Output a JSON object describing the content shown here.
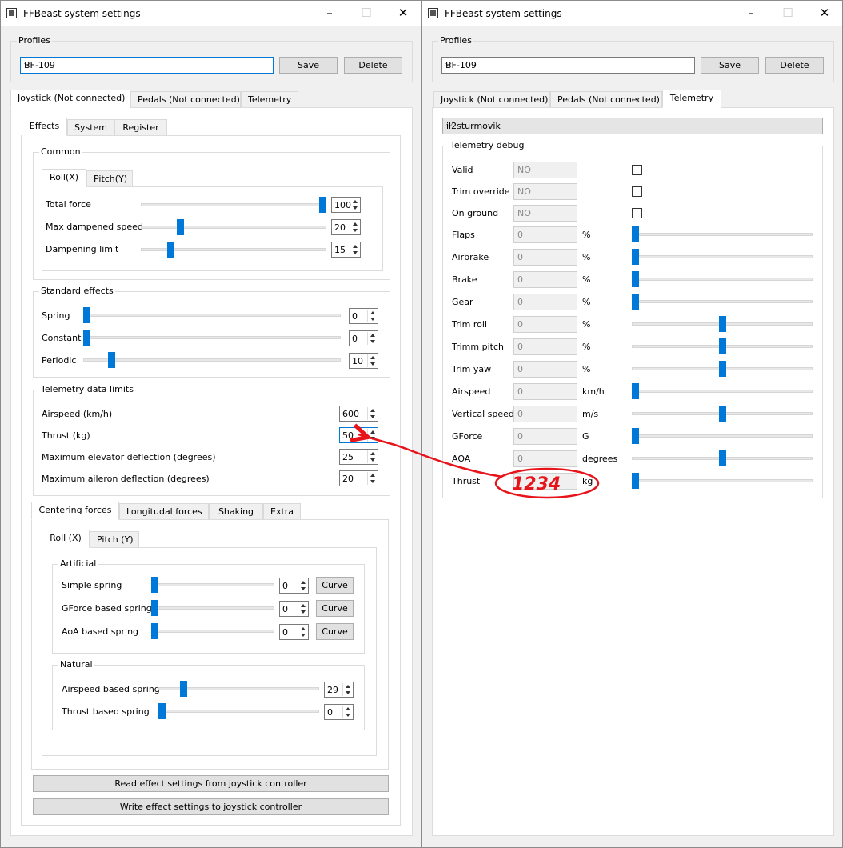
{
  "left_window": {
    "title": "FFBeast system settings",
    "profiles": {
      "label": "Profiles",
      "value": "BF-109",
      "save": "Save",
      "delete": "Delete"
    },
    "main_tabs": [
      "Joystick (Not connected)",
      "Pedals (Not connected)",
      "Telemetry"
    ],
    "sub_tabs": [
      "Effects",
      "System",
      "Register"
    ],
    "common": {
      "label": "Common",
      "tabs": [
        "Roll(X)",
        "Pitch(Y)"
      ],
      "rows": [
        {
          "label": "Total force",
          "value": "100",
          "pos": 1.0
        },
        {
          "label": "Max dampened speed",
          "value": "20",
          "pos": 0.2
        },
        {
          "label": "Dampening limit",
          "value": "15",
          "pos": 0.15
        }
      ]
    },
    "standard": {
      "label": "Standard effects",
      "rows": [
        {
          "label": "Spring",
          "value": "0",
          "pos": 0
        },
        {
          "label": "Constant",
          "value": "0",
          "pos": 0
        },
        {
          "label": "Periodic",
          "value": "10",
          "pos": 0.1
        }
      ]
    },
    "limits": {
      "label": "Telemetry data limits",
      "rows": [
        {
          "label": "Airspeed (km/h)",
          "value": "600"
        },
        {
          "label": "Thrust (kg)",
          "value": "50"
        },
        {
          "label": "Maximum elevator deflection (degrees)",
          "value": "25"
        },
        {
          "label": "Maximum aileron deflection (degrees)",
          "value": "20"
        }
      ]
    },
    "force_tabs": [
      "Centering forces",
      "Longitudal forces",
      "Shaking",
      "Extra"
    ],
    "axis_tabs": [
      "Roll (X)",
      "Pitch (Y)"
    ],
    "artificial": {
      "label": "Artificial",
      "curve": "Curve",
      "rows": [
        {
          "label": "Simple spring",
          "value": "0",
          "pos": 0
        },
        {
          "label": "GForce based spring",
          "value": "0",
          "pos": 0
        },
        {
          "label": "AoA based spring",
          "value": "0",
          "pos": 0
        }
      ]
    },
    "natural": {
      "label": "Natural",
      "rows": [
        {
          "label": "Airspeed based spring",
          "value": "29",
          "pos": 0.14
        },
        {
          "label": "Thrust based spring",
          "value": "0",
          "pos": 0
        }
      ]
    },
    "read_button": "Read effect settings from joystick controller",
    "write_button": "Write effect settings to joystick controller"
  },
  "right_window": {
    "title": "FFBeast system settings",
    "profiles": {
      "label": "Profiles",
      "value": "BF-109",
      "save": "Save",
      "delete": "Delete"
    },
    "main_tabs": [
      "Joystick (Not connected)",
      "Pedals (Not connected)",
      "Telemetry"
    ],
    "game": "il2sturmovik",
    "debug_label": "Telemetry debug",
    "bool_rows": [
      {
        "label": "Valid",
        "value": "NO",
        "checked": false
      },
      {
        "label": "Trim override",
        "value": "NO",
        "checked": false
      },
      {
        "label": "On ground",
        "value": "NO",
        "checked": false
      }
    ],
    "value_rows": [
      {
        "label": "Flaps",
        "value": "0",
        "unit": "%",
        "pos": 0
      },
      {
        "label": "Airbrake",
        "value": "0",
        "unit": "%",
        "pos": 0
      },
      {
        "label": "Brake",
        "value": "0",
        "unit": "%",
        "pos": 0
      },
      {
        "label": "Gear",
        "value": "0",
        "unit": "%",
        "pos": 0
      },
      {
        "label": "Trim roll",
        "value": "0",
        "unit": "%",
        "pos": 0.5
      },
      {
        "label": "Trimm pitch",
        "value": "0",
        "unit": "%",
        "pos": 0.5
      },
      {
        "label": "Trim yaw",
        "value": "0",
        "unit": "%",
        "pos": 0.5
      },
      {
        "label": "Airspeed",
        "value": "0",
        "unit": "km/h",
        "pos": 0
      },
      {
        "label": "Vertical speed",
        "value": "0",
        "unit": "m/s",
        "pos": 0.5
      },
      {
        "label": "GForce",
        "value": "0",
        "unit": "G",
        "pos": 0
      },
      {
        "label": "AOA",
        "value": "0",
        "unit": "degrees",
        "pos": 0.5
      },
      {
        "label": "Thrust",
        "value": "",
        "unit": "kg",
        "pos": 0
      }
    ]
  },
  "annotation": {
    "text": "1234",
    "color": "#e8141c"
  },
  "colors": {
    "accent": "#0078d7",
    "window": "#f0f0f0"
  },
  "icons": {
    "minimize": "–",
    "maximize": "☐",
    "close": "✕",
    "dropdown": "⌵"
  }
}
